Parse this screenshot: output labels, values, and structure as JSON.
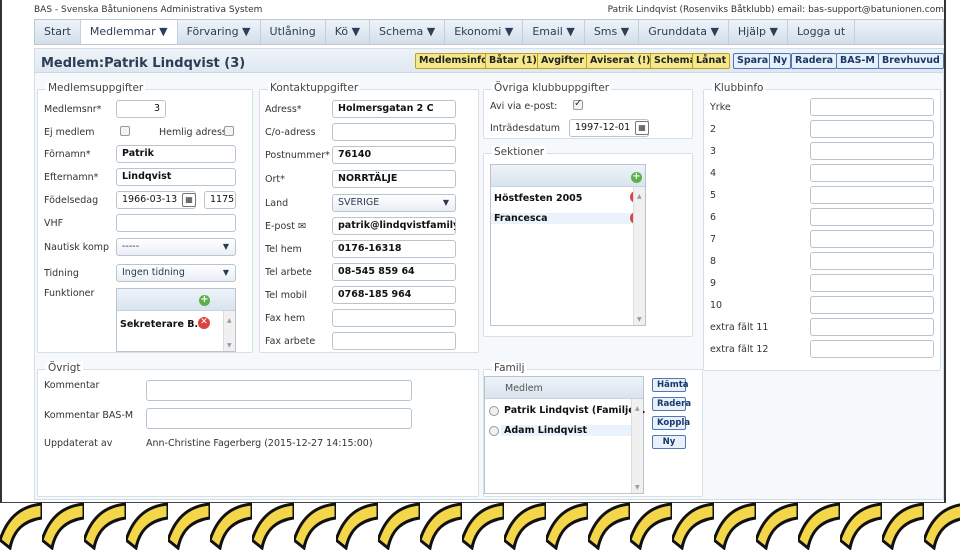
{
  "window": {
    "app_title": "BAS - Svenska Båtunionens Administrativa System",
    "user_info": "Patrik Lindqvist (Rosenviks Båtklubb) email: bas-support@batunionen.com"
  },
  "menu": [
    "Start",
    "Medlemmar ▼",
    "Förvaring ▼",
    "Utlåning",
    "Kö ▼",
    "Schema ▼",
    "Ekonomi ▼",
    "Email ▼",
    "Sms ▼",
    "Grunddata ▼",
    "Hjälp ▼",
    "Logga ut"
  ],
  "header": {
    "title": "Medlem:Patrik Lindqvist (3)"
  },
  "toolbar": {
    "medlemsinfo": "Medlemsinfo",
    "batar": "Båtar (1)",
    "avgifter": "Avgifter",
    "aviserat": "Aviserat (!)",
    "schema": "Schema",
    "lanat": "Lånat",
    "spara": "Spara",
    "ny": "Ny",
    "radera": "Radera",
    "basm": "BAS-M",
    "brevhuvud": "Brevhuvud"
  },
  "member": {
    "legend": "Medlemsuppgifter",
    "nr_label": "Medlemsnr*",
    "nr": "3",
    "ej_label": "Ej medlem",
    "hemlig_label": "Hemlig adress",
    "fornamn_label": "Förnamn*",
    "fornamn": "Patrik",
    "efternamn_label": "Efternamn*",
    "efternamn": "Lindqvist",
    "fodelse_label": "Födelsedag",
    "fodelse": "1966-03-13",
    "fodelse_suffix": "1175",
    "vhf_label": "VHF",
    "nautisk_label": "Nautisk komp",
    "nautisk": "-----",
    "tidning_label": "Tidning",
    "tidning": "Ingen tidning",
    "funktioner_label": "Funktioner",
    "funktion": "Sekreterare B..."
  },
  "contact": {
    "legend": "Kontaktuppgifter",
    "adress_label": "Adress*",
    "adress": "Holmersgatan 2 C",
    "coadress_label": "C/o-adress",
    "postnr_label": "Postnummer*",
    "postnr": "76140",
    "ort_label": "Ort*",
    "ort": "NORRTÄLJE",
    "land_label": "Land",
    "land": "SVERIGE",
    "epost_label": "E-post",
    "epost": "patrik@lindqvistfamily.s",
    "telhem_label": "Tel hem",
    "telhem": "0176-16318",
    "telarb_label": "Tel arbete",
    "telarb": "08-545 859 64",
    "telmob_label": "Tel mobil",
    "telmob": "0768-185 964",
    "faxhem_label": "Fax hem",
    "faxarb_label": "Fax arbete"
  },
  "club": {
    "legend": "Övriga klubbuppgifter",
    "avi_label": "Avi via e-post:",
    "intrade_label": "Inträdesdatum",
    "intrade": "1997-12-01"
  },
  "sektioner": {
    "legend": "Sektioner",
    "items": [
      "Höstfesten 2005",
      "Francesca"
    ]
  },
  "klubbinfo": {
    "legend": "Klubbinfo",
    "labels": [
      "Yrke",
      "2",
      "3",
      "4",
      "5",
      "6",
      "7",
      "8",
      "9",
      "10",
      "extra fält 11",
      "extra fält 12"
    ]
  },
  "ovrigt": {
    "legend": "Övrigt",
    "kommentar_label": "Kommentar",
    "kommentar_basm_label": "Kommentar BAS-M",
    "uppdaterat_label": "Uppdaterat av",
    "uppdaterat": "Ann-Christine Fagerberg (2015-12-27 14:15:00)"
  },
  "familj": {
    "legend": "Familj",
    "col": "Medlem",
    "members": [
      "Patrik Lindqvist (Familje...",
      "Adam Lindqvist"
    ],
    "hamta": "Hämta",
    "radera": "Radera",
    "koppla": "Koppla",
    "ny": "Ny"
  }
}
